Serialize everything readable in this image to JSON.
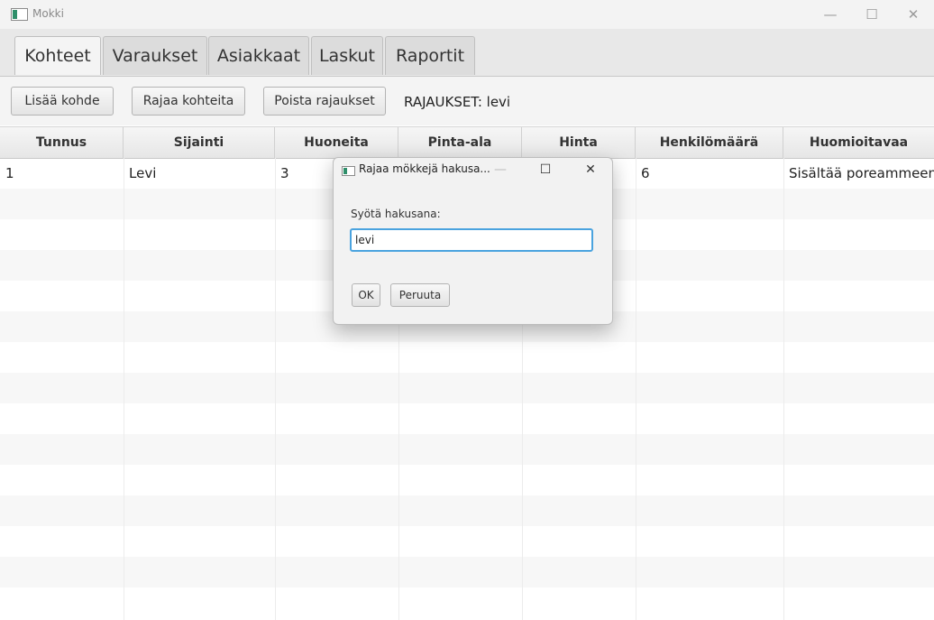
{
  "window": {
    "title": "Mokki",
    "icon": "app-window-icon",
    "minimize": "—",
    "maximize": "☐",
    "close": "✕"
  },
  "tabs": [
    {
      "label": "Kohteet",
      "active": true
    },
    {
      "label": "Varaukset",
      "active": false
    },
    {
      "label": "Asiakkaat",
      "active": false
    },
    {
      "label": "Laskut",
      "active": false
    },
    {
      "label": "Raportit",
      "active": false
    }
  ],
  "toolbar": {
    "add_label": "Lisää kohde",
    "filter_label": "Rajaa kohteita",
    "clear_label": "Poista rajaukset",
    "status": "RAJAUKSET: levi"
  },
  "table": {
    "columns": [
      "Tunnus",
      "Sijainti",
      "Huoneita",
      "Pinta-ala",
      "Hinta",
      "Henkilömäärä",
      "Huomioitavaa"
    ],
    "rows": [
      {
        "tunnus": "1",
        "sijainti": "Levi",
        "huoneita": "3",
        "henkilomaara": "6",
        "huomioitavaa": "Sisältää poreammeen"
      }
    ]
  },
  "dialog": {
    "title": "Rajaa mökkejä hakusa...",
    "minimize": "—",
    "maximize": "☐",
    "close": "✕",
    "prompt": "Syötä hakusana:",
    "input_value": "levi",
    "ok_label": "OK",
    "cancel_label": "Peruuta"
  }
}
